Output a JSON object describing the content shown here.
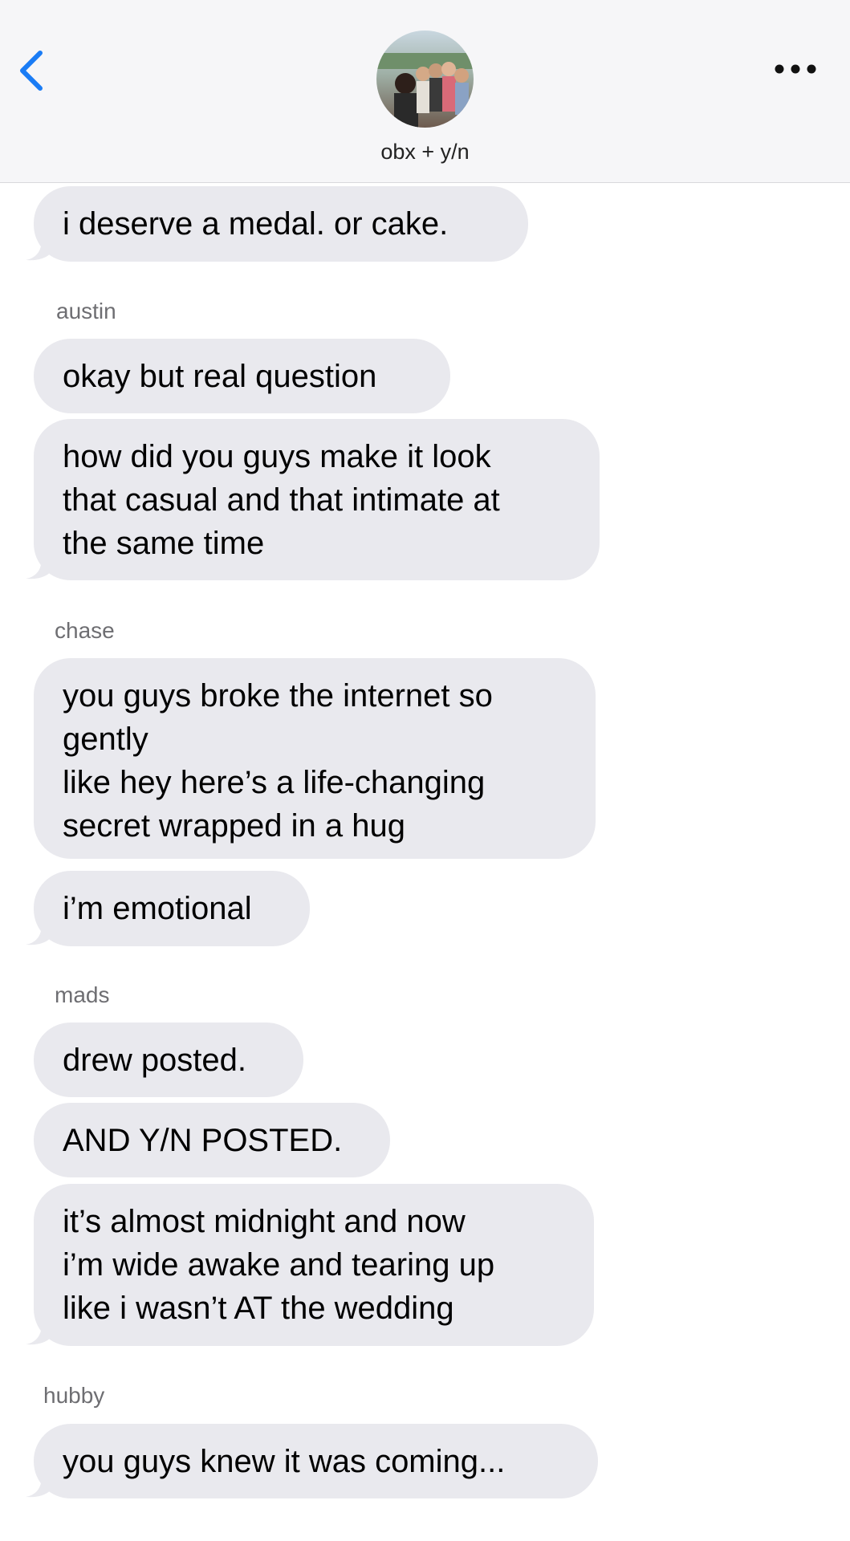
{
  "header": {
    "title": "obx + y/n",
    "back_icon": "chevron-left-icon",
    "more_icon": "ellipsis-icon",
    "accent_color": "#1a7cf5"
  },
  "messages": [
    {
      "sender": null,
      "texts": [
        "i deserve a medal. or cake."
      ]
    },
    {
      "sender": "austin",
      "texts": [
        "okay but real question",
        "how did you guys make it look\nthat casual and that intimate at\nthe same time"
      ]
    },
    {
      "sender": "chase",
      "texts": [
        "you guys broke the internet so\ngently\nlike hey here’s a life-changing\nsecret wrapped in a hug",
        "i’m emotional"
      ]
    },
    {
      "sender": "mads",
      "texts": [
        "drew posted.",
        "AND Y/N POSTED.",
        "it’s almost midnight and now\ni’m wide awake and tearing up\nlike i wasn’t AT the wedding"
      ]
    },
    {
      "sender": "hubby",
      "texts": [
        "you guys knew it was coming..."
      ]
    }
  ],
  "colors": {
    "bubble": "#e9e9ee",
    "header_bg": "#f6f6f8",
    "sender_text": "#6e6e72"
  }
}
